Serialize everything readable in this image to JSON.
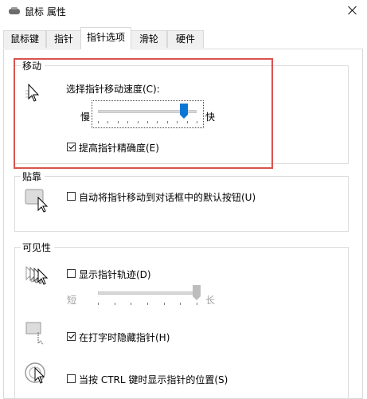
{
  "window": {
    "title": "鼠标 属性"
  },
  "tabs": [
    {
      "label": "鼠标键"
    },
    {
      "label": "指针"
    },
    {
      "label": "指针选项",
      "active": true
    },
    {
      "label": "滑轮"
    },
    {
      "label": "硬件"
    }
  ],
  "motion": {
    "group_title": "移动",
    "speed_label": "选择指针移动速度(C):",
    "slow_label": "慢",
    "fast_label": "快",
    "speed_value": 0.87,
    "precision_label": "提高指针精确度(E)",
    "precision_checked": true
  },
  "snap": {
    "group_title": "贴靠",
    "snap_label": "自动将指针移动到对话框中的默认按钮(U)",
    "snap_checked": false
  },
  "visibility": {
    "group_title": "可见性",
    "trails_label": "显示指针轨迹(D)",
    "trails_checked": false,
    "short_label": "短",
    "long_label": "长",
    "trails_value": 1.0,
    "hide_label": "在打字时隐藏指针(H)",
    "hide_checked": true,
    "ctrl_label": "当按 CTRL 键时显示指针的位置(S)",
    "ctrl_checked": false
  },
  "colors": {
    "highlight": "#d9534f",
    "thumb_active": "#0a77d5",
    "thumb_disabled": "#bdbdbd"
  }
}
